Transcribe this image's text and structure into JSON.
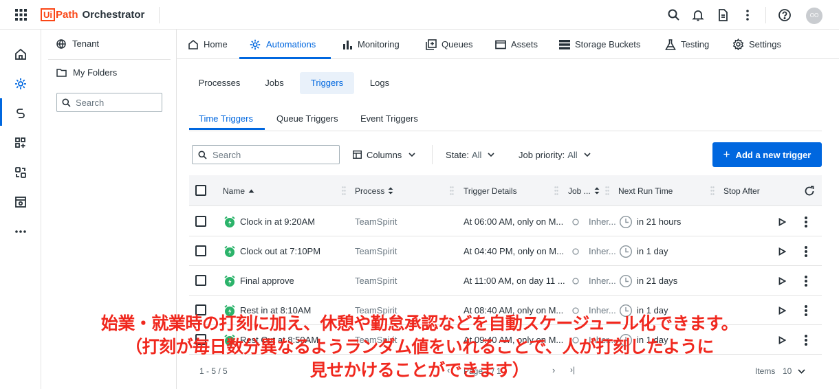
{
  "app": {
    "logo_box": "Ui",
    "logo_path": "Path",
    "logo_product": "Orchestrator",
    "avatar_initials": "OO",
    "brand_color": "#fa4616",
    "accent_color": "#0067df"
  },
  "topbar_icons": [
    "search-icon",
    "bell-icon",
    "document-icon",
    "more-vertical-icon",
    "help-icon"
  ],
  "rail_icons": [
    "home-icon",
    "automations-icon",
    "integration-icon",
    "apps-add-icon",
    "connections-icon",
    "admin-icon",
    "more-horizontal-icon"
  ],
  "folders": {
    "tenant": "Tenant",
    "my_folders": "My Folders",
    "search_placeholder": "Search"
  },
  "nav": {
    "home": "Home",
    "automations": "Automations",
    "monitoring": "Monitoring",
    "queues": "Queues",
    "assets": "Assets",
    "storage_buckets": "Storage Buckets",
    "testing": "Testing",
    "settings": "Settings",
    "active": "Automations"
  },
  "subtabs": {
    "processes": "Processes",
    "jobs": "Jobs",
    "triggers": "Triggers",
    "logs": "Logs",
    "active": "Triggers"
  },
  "trigger_tabs": {
    "time": "Time Triggers",
    "queue": "Queue Triggers",
    "event": "Event Triggers",
    "active": "Time Triggers"
  },
  "toolbar": {
    "search_placeholder": "Search",
    "columns_label": "Columns",
    "state_label": "State:",
    "state_value": "All",
    "priority_label": "Job priority:",
    "priority_value": "All",
    "add_button": "Add a new trigger"
  },
  "table": {
    "headers": {
      "name": "Name",
      "process": "Process",
      "trigger_details": "Trigger Details",
      "job_priority": "Job ...",
      "next_run": "Next Run Time",
      "stop_after": "Stop After"
    },
    "rows": [
      {
        "name": "Clock in at 9:20AM",
        "process": "TeamSpirit",
        "details": "At 06:00 AM, only on M...",
        "priority": "Inher...",
        "next_run": "in 21 hours"
      },
      {
        "name": "Clock out at 7:10PM",
        "process": "TeamSpirit",
        "details": "At 04:40 PM, only on M...",
        "priority": "Inher...",
        "next_run": "in 1 day"
      },
      {
        "name": "Final approve",
        "process": "TeamSpirit",
        "details": "At 11:00 AM, on day 11 ...",
        "priority": "Inher...",
        "next_run": "in 21 days"
      },
      {
        "name": "Rest in at 8:10AM",
        "process": "TeamSpirit",
        "details": "At 08:40 AM, only on M...",
        "priority": "Inher...",
        "next_run": "in 1 day"
      },
      {
        "name": "Rest Out at 8:50AM",
        "process": "TeamSpirit",
        "details": "At 09:40 AM, only on M...",
        "priority": "Inher...",
        "next_run": "in 1 day"
      }
    ]
  },
  "footer": {
    "range": "1 - 5 / 5",
    "page": "Page 1 / 1",
    "items_label": "Items",
    "items_value": "10"
  },
  "caption": {
    "line1": "始業・就業時の打刻に加え、休憩や勤怠承認などを自動スケージュール化できます。",
    "line2": "（打刻が毎日数分異なるようランダム値をいれることで、人が打刻したように",
    "line3": "見せかけることができます）",
    "color": "#f0281e"
  }
}
